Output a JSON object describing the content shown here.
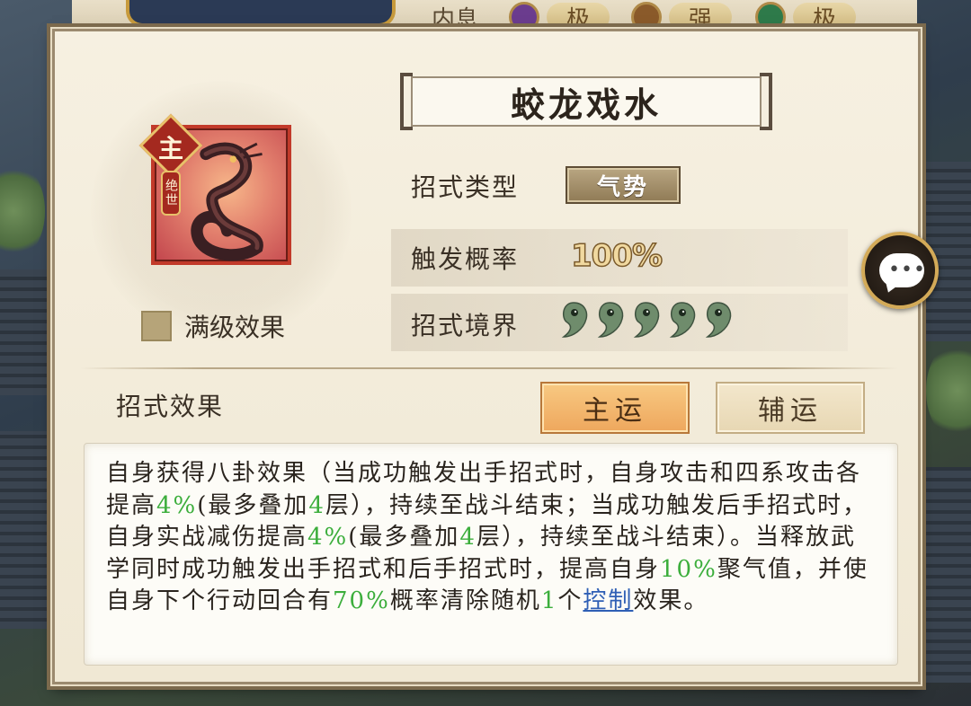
{
  "top_bar": {
    "label": "内息",
    "items": [
      {
        "grade": "极",
        "gem_color": "#6b3c8e"
      },
      {
        "grade": "强",
        "gem_color": "#8a5a2a"
      },
      {
        "grade": "极",
        "gem_color": "#2e7a4a"
      }
    ]
  },
  "skill": {
    "name": "蛟龙戏水",
    "badge_main": "主",
    "badge_rare": "绝世",
    "icon": "dragon-icon",
    "max_level_label": "满级效果",
    "type_label": "招式类型",
    "type_value": "气势",
    "rate_label": "触发概率",
    "rate_value": "100%",
    "realm_label": "招式境界",
    "realm_level": 5,
    "realm_max": 5
  },
  "effect": {
    "label": "招式效果",
    "tabs": [
      {
        "label": "主运",
        "active": true
      },
      {
        "label": "辅运",
        "active": false
      }
    ],
    "description_segments": [
      {
        "t": "自身获得八卦效果（当成功触发出手招式时，自身攻击和四系攻击各提高",
        "s": ""
      },
      {
        "t": "4%",
        "s": "hl"
      },
      {
        "t": "(最多叠加",
        "s": ""
      },
      {
        "t": "4",
        "s": "hl"
      },
      {
        "t": "层），持续至战斗结束；当成功触发后手招式时，自身实战减伤提高",
        "s": ""
      },
      {
        "t": "4%",
        "s": "hl"
      },
      {
        "t": "(最多叠加",
        "s": ""
      },
      {
        "t": "4",
        "s": "hl"
      },
      {
        "t": "层），持续至战斗结束）。当释放武学同时成功触发出手招式和后手招式时，提高自身",
        "s": ""
      },
      {
        "t": "10%",
        "s": "hl"
      },
      {
        "t": "聚气值，并使自身下个行动回合有",
        "s": ""
      },
      {
        "t": "70%",
        "s": "hl"
      },
      {
        "t": "概率清除随机",
        "s": ""
      },
      {
        "t": "1",
        "s": "hl"
      },
      {
        "t": "个",
        "s": ""
      },
      {
        "t": "控制",
        "s": "link"
      },
      {
        "t": "效果。",
        "s": ""
      }
    ]
  },
  "chat": {
    "icon": "chat-bubble-icon"
  }
}
